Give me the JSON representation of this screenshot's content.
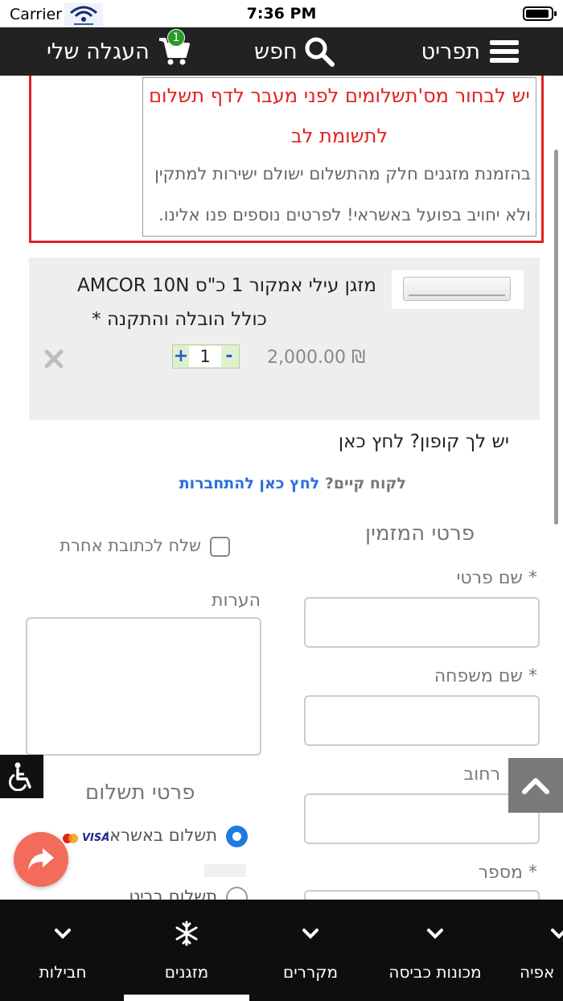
{
  "status_bar": {
    "carrier": "Carrier",
    "time": "7:36 PM"
  },
  "top_nav": {
    "menu_label": "תפריט",
    "search_label": "חפש",
    "cart_label": "העגלה שלי",
    "cart_count": "1"
  },
  "notice": {
    "line1": "יש לבחור מס'תשלומים לפני מעבר לדף תשלום",
    "line2": "לתשומת לב",
    "line3": "בהזמנת מזגנים חלק מהתשלום ישולם ישירות למתקין",
    "line4": "ולא יחויב בפועל באשראי! לפרטים נוספים פנו אלינו."
  },
  "cart_item": {
    "title_line1": "מזגן עילי אמקור 1 כ\"ס AMCOR 10N",
    "title_line2": "כולל הובלה והתקנה *",
    "quantity": "1",
    "qty_plus": "+",
    "qty_minus": "-",
    "price": "2,000.00 ₪",
    "remove_icon": "close-icon"
  },
  "coupon": {
    "text": "יש לך קופון? לחץ כאן"
  },
  "login": {
    "prefix": "לקוח קיים?",
    "link": "לחץ כאן להתחברות"
  },
  "billing": {
    "heading": "פרטי המזמין",
    "first_name_label": "* שם פרטי",
    "last_name_label": "* שם משפחה",
    "street_label": "רחוב",
    "number_label": "* מספר",
    "first_name_value": "",
    "last_name_value": "",
    "street_value": ""
  },
  "shipping": {
    "ship_other_label": "שלח לכתובת אחרת",
    "notes_label": "הערות",
    "notes_value": ""
  },
  "payment": {
    "heading": "פרטי תשלום",
    "option_credit": "תשלום באשראי",
    "option_bit": "תשלום בביט",
    "visa_text": "VISA"
  },
  "bottom_nav": {
    "items": [
      {
        "label": "חבילות",
        "icon": "chevron-down-icon"
      },
      {
        "label": "מזגנים",
        "icon": "snowflake-icon"
      },
      {
        "label": "מקררים",
        "icon": "chevron-down-icon"
      },
      {
        "label": "מכונות כביסה",
        "icon": "chevron-down-icon"
      },
      {
        "label": "אפיה",
        "icon": "chevron-down-icon"
      }
    ],
    "active_index": 1
  },
  "colors": {
    "nav_bg": "#222222",
    "notice_red": "#e42020",
    "link_blue": "#2a6fdb",
    "radio_blue": "#1e7be0",
    "share_coral": "#f26b5b",
    "badge_green": "#2a9a2a"
  }
}
